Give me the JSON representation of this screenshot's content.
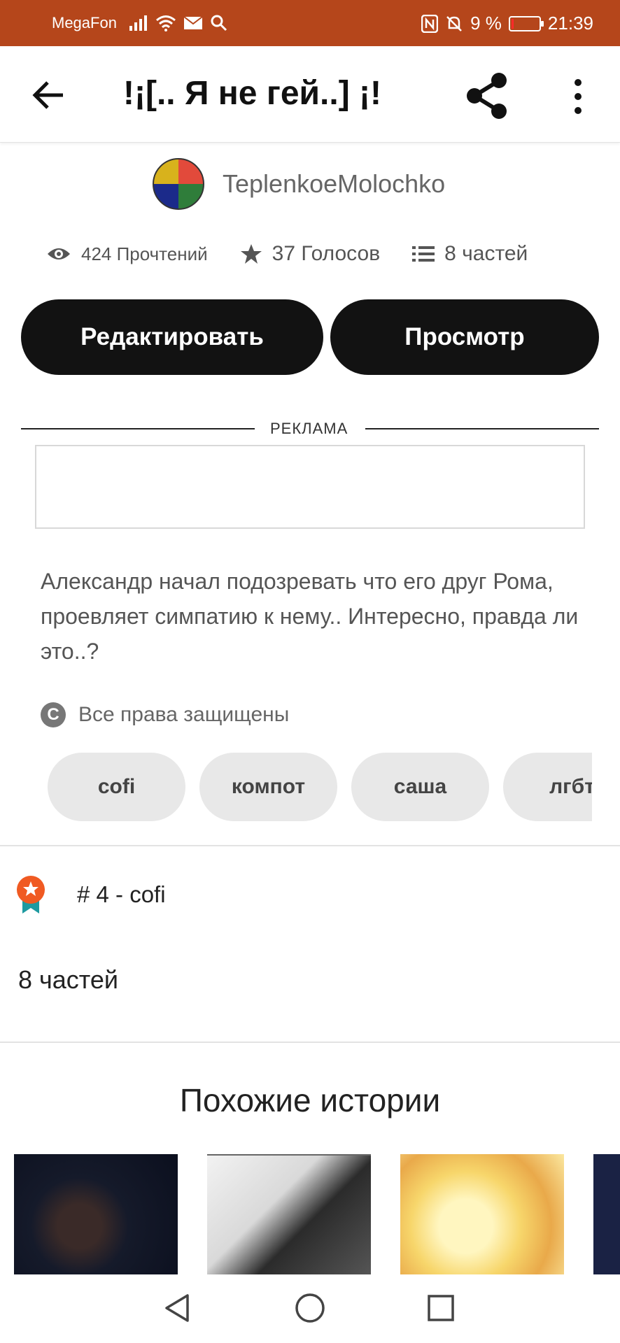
{
  "status_bar": {
    "carrier": "MegaFon",
    "battery": "9 %",
    "battery_level": 0.09,
    "time": "21:39",
    "bg_color": "#b5461b",
    "icons": [
      "signal-icon",
      "wifi-icon",
      "mail-icon",
      "search-icon",
      "nfc-icon",
      "bell-muted-icon",
      "battery-icon"
    ]
  },
  "top_bar": {
    "title": "!¡[.. Я не гей..] ¡!",
    "back_icon": "arrow-left-icon",
    "share_icon": "share-icon",
    "more_icon": "more-vertical-icon"
  },
  "author": {
    "name": "TeplenkoeMolochko"
  },
  "stats": {
    "reads": "424 Прочтений",
    "votes": "37 Голосов",
    "parts": "8 частей"
  },
  "actions": {
    "edit": "Редактировать",
    "view": "Просмотр"
  },
  "ad": {
    "label": "РЕКЛАМА"
  },
  "description": "Александр начал подозревать что его друг Рома, проевляет симпатию к нему.. Интересно, правда ли это..?",
  "rights": {
    "text": "Все права защищены"
  },
  "tags": [
    "cofi",
    "компот",
    "саша",
    "лгбт"
  ],
  "ranking": {
    "text": "# 4 - cofi",
    "badge_color": "#f05a22",
    "ribbon_color": "#1e9aa0"
  },
  "parts_label": "8 частей",
  "similar": {
    "title": "Похожие истории"
  },
  "colors": {
    "button_bg": "#121212",
    "tag_bg": "#e8e8e8"
  }
}
